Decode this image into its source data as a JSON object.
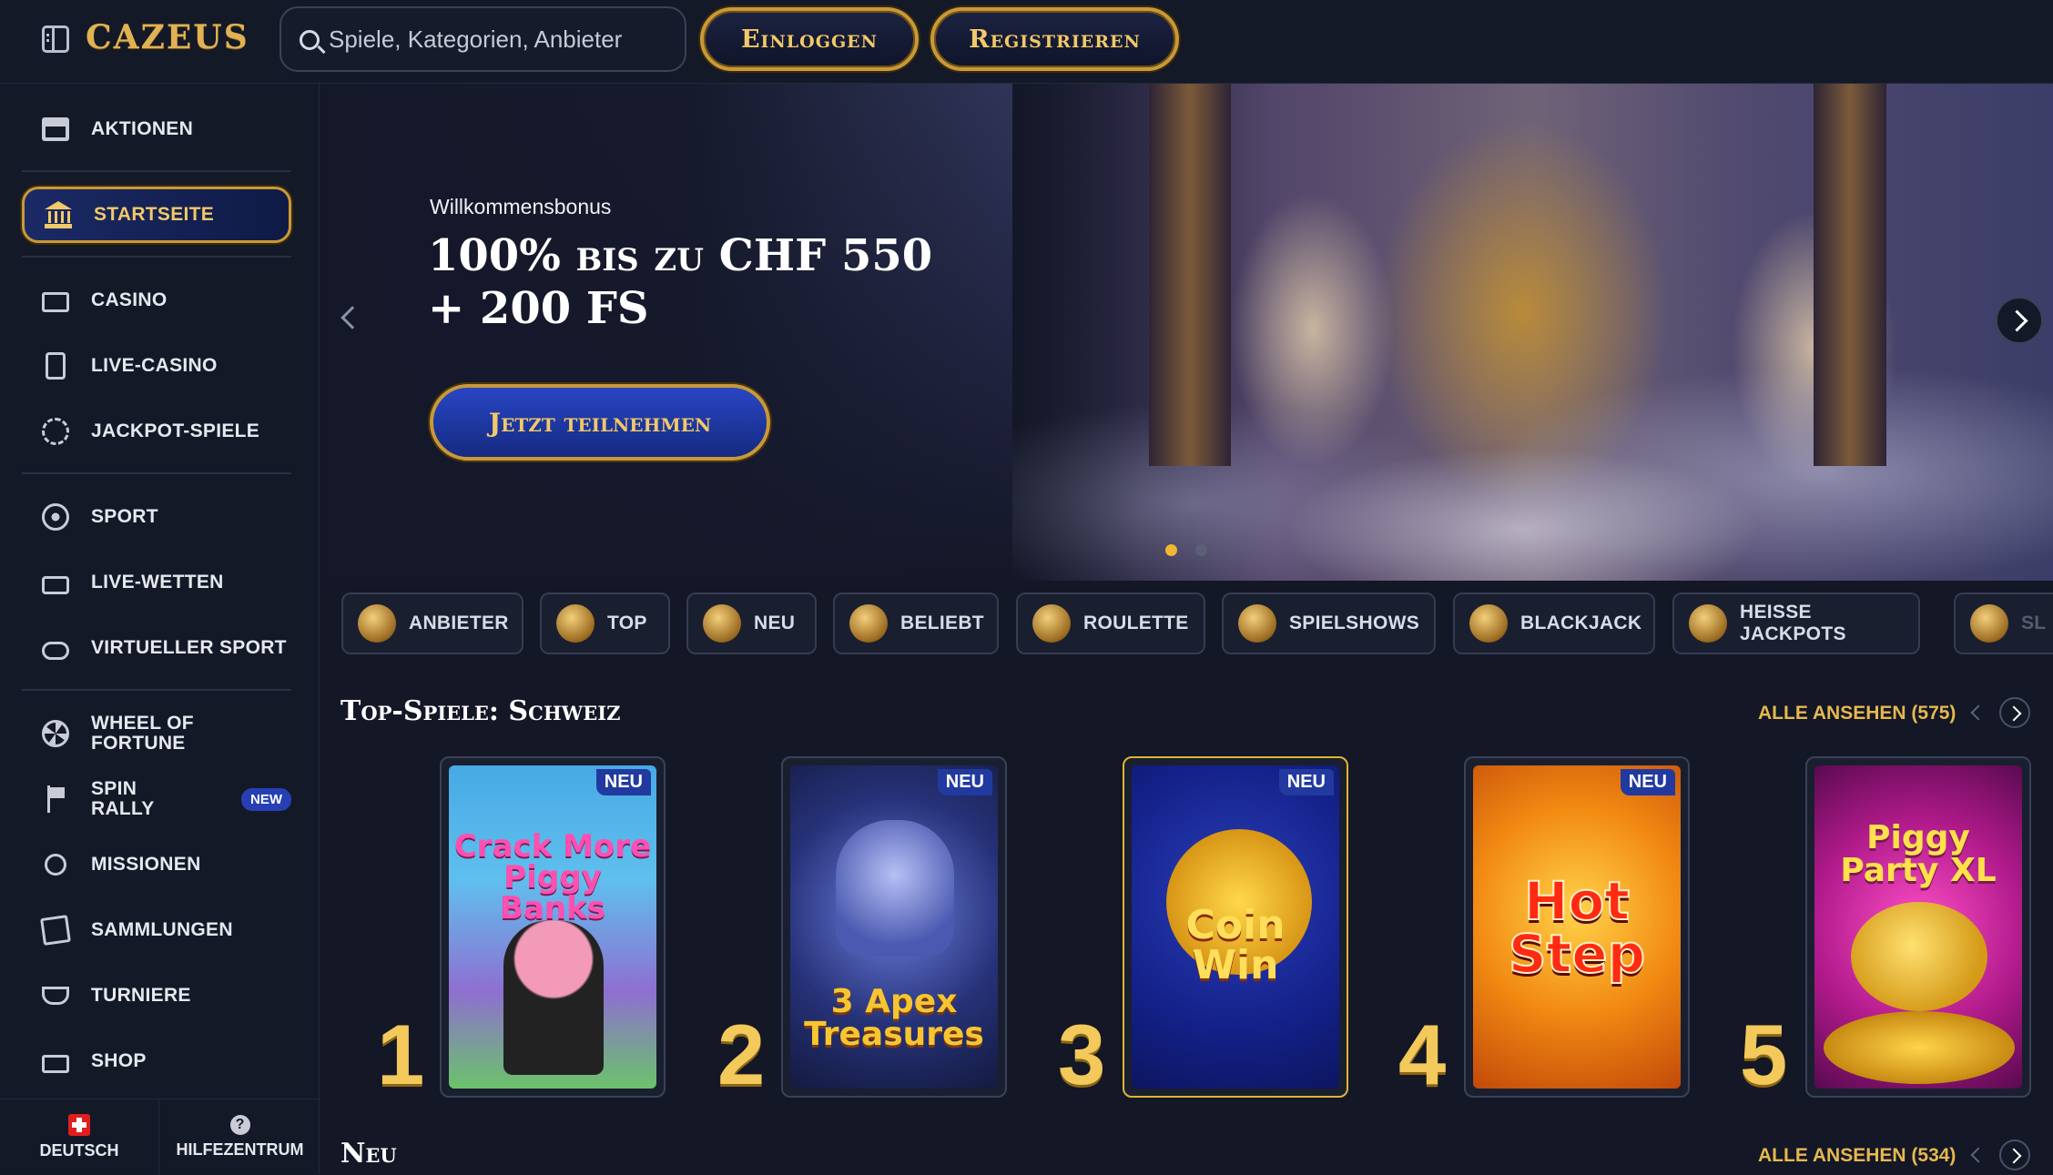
{
  "header": {
    "logo_text": "CAZEUS",
    "search_placeholder": "Spiele, Kategorien, Anbieter",
    "login_label": "Einloggen",
    "register_label": "Registrieren"
  },
  "sidebar": {
    "items": [
      {
        "label": "AKTIONEN",
        "icon": "gift-icon"
      },
      {
        "label": "STARTSEITE",
        "icon": "bank-icon",
        "active": true
      },
      {
        "label": "CASINO",
        "icon": "slot-machine-icon"
      },
      {
        "label": "LIVE-CASINO",
        "icon": "playing-card-icon"
      },
      {
        "label": "JACKPOT-SPIELE",
        "icon": "jackpot-chip-icon"
      },
      {
        "label": "SPORT",
        "icon": "soccer-ball-icon"
      },
      {
        "label": "LIVE-WETTEN",
        "icon": "live-tv-icon"
      },
      {
        "label": "VIRTUELLER SPORT",
        "icon": "gamepad-icon"
      },
      {
        "label": "WHEEL OF FORTUNE",
        "icon": "wheel-icon"
      },
      {
        "label": "SPIN RALLY",
        "icon": "flag-icon",
        "badge": "NEW"
      },
      {
        "label": "MISSIONEN",
        "icon": "mission-target-icon"
      },
      {
        "label": "SAMMLUNGEN",
        "icon": "cards-collection-icon"
      },
      {
        "label": "TURNIERE",
        "icon": "trophy-icon"
      },
      {
        "label": "SHOP",
        "icon": "shop-icon"
      }
    ],
    "footer": {
      "language_label": "DEUTSCH",
      "help_label": "HILFEZENTRUM",
      "help_glyph": "?"
    }
  },
  "hero": {
    "subtitle": "Willkommensbonus",
    "title": "100% bis zu CHF 550 + 200 FS",
    "cta_label": "Jetzt teilnehmen",
    "slides_total": 2,
    "active_slide": 1
  },
  "categories": [
    {
      "label": "ANBIETER",
      "icon": "pillar-icon"
    },
    {
      "label": "TOP",
      "icon": "star-badge-icon"
    },
    {
      "label": "NEU",
      "icon": "lightning-icon"
    },
    {
      "label": "BELIEBT",
      "icon": "crown-icon"
    },
    {
      "label": "ROULETTE",
      "icon": "roulette-icon"
    },
    {
      "label": "SPIELSHOWS",
      "icon": "wheel-show-icon"
    },
    {
      "label": "BLACKJACK",
      "icon": "blackjack-icon"
    },
    {
      "label": "HEISSE JACKPOTS",
      "icon": "flame-icon"
    },
    {
      "label": "SL",
      "icon": "slot-icon"
    }
  ],
  "top_games": {
    "title": "Top-Spiele: Schweiz",
    "see_all_label": "ALLE ANSEHEN (575)",
    "games": [
      {
        "rank": "1",
        "title": "Crack More Piggy Banks",
        "badge": "NEU",
        "bg": "#4aa8e0"
      },
      {
        "rank": "2",
        "title": "3 Apex Treasures",
        "badge": "NEU",
        "bg": "#2a3a7a"
      },
      {
        "rank": "3",
        "title": "Coin Win",
        "badge": "NEU",
        "bg": "#16288a"
      },
      {
        "rank": "4",
        "title": "Hot Step",
        "badge": "NEU",
        "bg": "#f07a10"
      },
      {
        "rank": "5",
        "title": "Piggy Party XL",
        "badge": "",
        "bg": "#c0207a"
      }
    ]
  },
  "new_games": {
    "title": "Neu",
    "see_all_label": "ALLE ANSEHEN (534)"
  },
  "colors": {
    "accent_gold": "#e7b84f",
    "background": "#131726",
    "panel": "#141927",
    "active_blue": "#1b2a66"
  }
}
